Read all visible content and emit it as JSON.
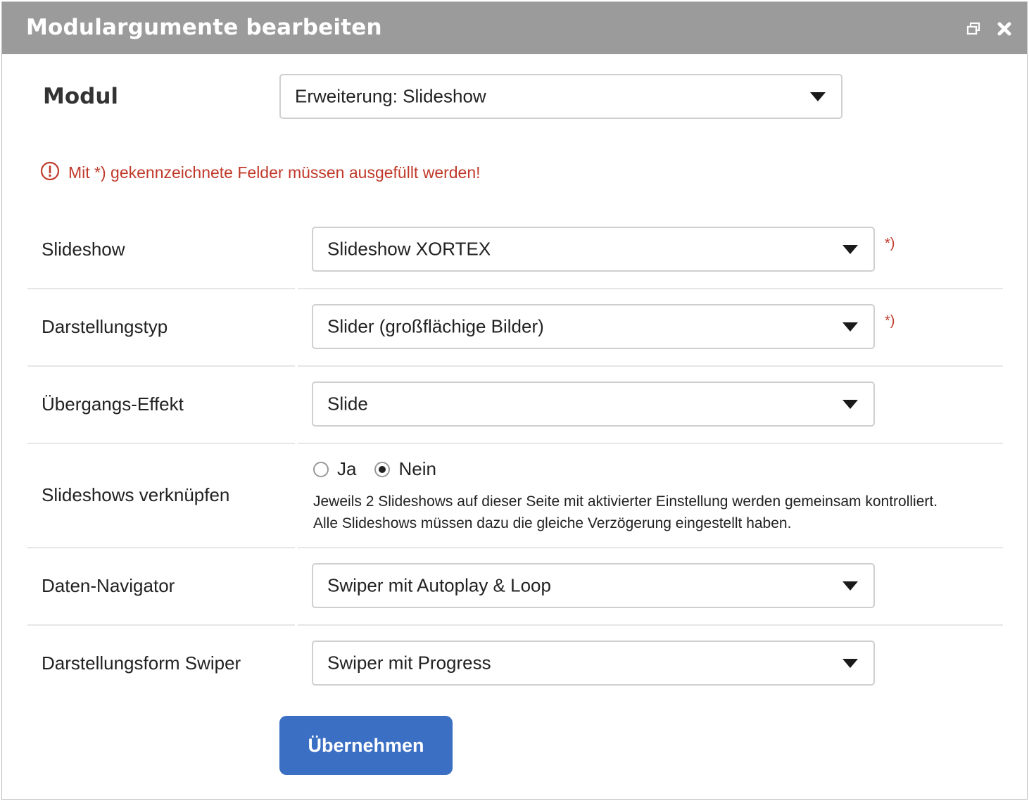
{
  "window": {
    "title": "Modulargumente bearbeiten",
    "restore_icon": "restore-window-icon",
    "close_icon": "close-icon"
  },
  "modul": {
    "label": "Modul",
    "value": "Erweiterung: Slideshow"
  },
  "notice": {
    "icon": "alert-circle-icon",
    "text": "Mit *) gekennzeichnete Felder müssen ausgefüllt werden!"
  },
  "required_marker": "*)",
  "fields": {
    "slideshow": {
      "label": "Slideshow",
      "value": "Slideshow XORTEX",
      "required": true
    },
    "darstellungstyp": {
      "label": "Darstellungstyp",
      "value": "Slider (großflächige Bilder)",
      "required": true
    },
    "uebergang": {
      "label": "Übergangs-Effekt",
      "value": "Slide",
      "required": false
    },
    "verknuepfen": {
      "label": "Slideshows verknüpfen",
      "options": [
        {
          "label": "Ja",
          "checked": false
        },
        {
          "label": "Nein",
          "checked": true
        }
      ],
      "help_line1": "Jeweils 2 Slideshows auf dieser Seite mit aktivierter Einstellung werden gemeinsam kontrolliert.",
      "help_line2": "Alle Slideshows müssen dazu die gleiche Verzögerung eingestellt haben."
    },
    "navigator": {
      "label": "Daten-Navigator",
      "value": "Swiper mit Autoplay & Loop",
      "required": false
    },
    "swiper_form": {
      "label": "Darstellungsform Swiper",
      "value": "Swiper mit Progress",
      "required": false
    }
  },
  "submit_label": "Übernehmen",
  "colors": {
    "titlebar": "#9b9b9b",
    "error": "#c0392b",
    "primary_button": "#3a6fc4"
  }
}
